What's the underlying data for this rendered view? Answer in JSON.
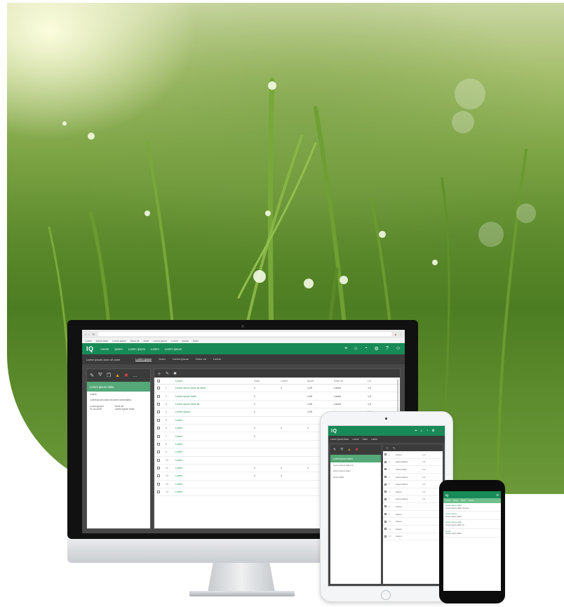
{
  "app": {
    "logo": "IQ",
    "nav": [
      "Lorem",
      "Ipsum",
      "Lorem ipsum",
      "Lorem",
      "Lorem ipsum"
    ],
    "accent_color": "#188a57",
    "panel_color": "#55a877"
  },
  "browser": {
    "bookmarks": [
      "Lorem",
      "Ipsum dolor",
      "Lorem ipsum",
      "Dolor sit",
      "Amet",
      "Lorem ipsum",
      "Lorem",
      "Ipsum",
      "Dolor"
    ]
  },
  "desktop": {
    "breadcrumb": "Lorem ipsum dolor sit amet",
    "tabs": [
      "Lorem ipsum",
      "Dolor",
      "Lorem ipsum",
      "Dolor sit",
      "Lorem"
    ],
    "left_panel": {
      "title": "Lorem ipsum dolor",
      "line1": "Lorem",
      "line2": "Lorem ipsum dolor sit amet consectetur",
      "meta_a_label": "Lorem ipsum",
      "meta_a_value": "01.01.2020",
      "meta_b_label": "Dolor sit",
      "meta_b_value": "Lorem ipsum dolor"
    },
    "table": {
      "headers": [
        "",
        "Lorem",
        "Dolor",
        "Lorem",
        "Ipsum",
        "Dolor sit",
        "Lor"
      ],
      "rows": [
        {
          "n": "1",
          "name": "Lorem ipsum dolor sit amet",
          "a": "1",
          "b": "1",
          "c": "1,00",
          "d": "Lorem",
          "e": "1,0"
        },
        {
          "n": "2",
          "name": "Lorem ipsum dolor",
          "a": "1",
          "b": "",
          "c": "1,00",
          "d": "Lorem",
          "e": "1,0"
        },
        {
          "n": "3",
          "name": "Lorem ipsum dolor sit",
          "a": "1",
          "b": "",
          "c": "1,00",
          "d": "Lorem",
          "e": "1,0"
        },
        {
          "n": "4",
          "name": "Lorem ipsum",
          "a": "1",
          "b": "",
          "c": "1,00",
          "d": "",
          "e": "1,0"
        },
        {
          "n": "5",
          "name": "Lorem",
          "a": "",
          "b": "",
          "c": "",
          "d": "",
          "e": ""
        },
        {
          "n": "6",
          "name": "Lorem",
          "a": "1",
          "b": "1",
          "c": "1",
          "d": "",
          "e": ""
        },
        {
          "n": "7",
          "name": "Lorem",
          "a": "1",
          "b": "",
          "c": "",
          "d": "",
          "e": ""
        },
        {
          "n": "8",
          "name": "Lorem",
          "a": "",
          "b": "",
          "c": "",
          "d": "",
          "e": ""
        },
        {
          "n": "9",
          "name": "Lorem",
          "a": "",
          "b": "",
          "c": "",
          "d": "",
          "e": ""
        },
        {
          "n": "10",
          "name": "Lorem",
          "a": "",
          "b": "",
          "c": "",
          "d": "",
          "e": ""
        },
        {
          "n": "11",
          "name": "Lorem",
          "a": "1",
          "b": "1",
          "c": "1",
          "d": "",
          "e": ""
        },
        {
          "n": "12",
          "name": "Lorem",
          "a": "1",
          "b": "1",
          "c": "",
          "d": "",
          "e": ""
        },
        {
          "n": "13",
          "name": "Lorem",
          "a": "",
          "b": "",
          "c": "",
          "d": "",
          "e": ""
        },
        {
          "n": "14",
          "name": "Lorem",
          "a": "",
          "b": "",
          "c": "",
          "d": "",
          "e": ""
        }
      ]
    }
  },
  "tablet": {
    "tabs": [
      "Lorem ipsum dolor",
      "Lorem",
      "Dolor",
      "Lorem"
    ],
    "left_panel": {
      "title": "Lorem ipsum dolor",
      "line1": "Lorem ipsum dolor sit",
      "line2": "Lorem ipsum dolor",
      "meta": "01.01.2020"
    },
    "rows": [
      {
        "n": "1",
        "name": "Lorem",
        "v": "1,0"
      },
      {
        "n": "2",
        "name": "Lorem ipsum",
        "v": "1,0"
      },
      {
        "n": "3",
        "name": "Lorem dolor",
        "v": "1,0"
      },
      {
        "n": "4",
        "name": "Lorem ipsum",
        "v": "1,0"
      },
      {
        "n": "5",
        "name": "Lorem ipsum",
        "v": "1,0"
      },
      {
        "n": "6",
        "name": "Lorem",
        "v": "1,0"
      },
      {
        "n": "7",
        "name": "Lorem ipsum",
        "v": "1,0"
      },
      {
        "n": "8",
        "name": "Lorem",
        "v": ""
      },
      {
        "n": "9",
        "name": "Lorem",
        "v": ""
      },
      {
        "n": "10",
        "name": "Lorem",
        "v": ""
      },
      {
        "n": "11",
        "name": "Lorem",
        "v": ""
      },
      {
        "n": "12",
        "name": "Lorem",
        "v": ""
      }
    ]
  },
  "phone": {
    "tabs": [
      "Lorem",
      "Ipsum",
      "Dolor",
      "Lorem"
    ],
    "items": [
      {
        "title": "Lorem ipsum dolor",
        "sub": "Lorem ipsum dolor sit amet"
      },
      {
        "title": "Lorem ipsum",
        "sub": "Lorem ipsum dolor"
      },
      {
        "title": "Lorem ipsum dolor",
        "sub": "Lorem ipsum dolor sit"
      },
      {
        "title": "Lorem",
        "sub": "Lorem ipsum dolor"
      }
    ]
  }
}
